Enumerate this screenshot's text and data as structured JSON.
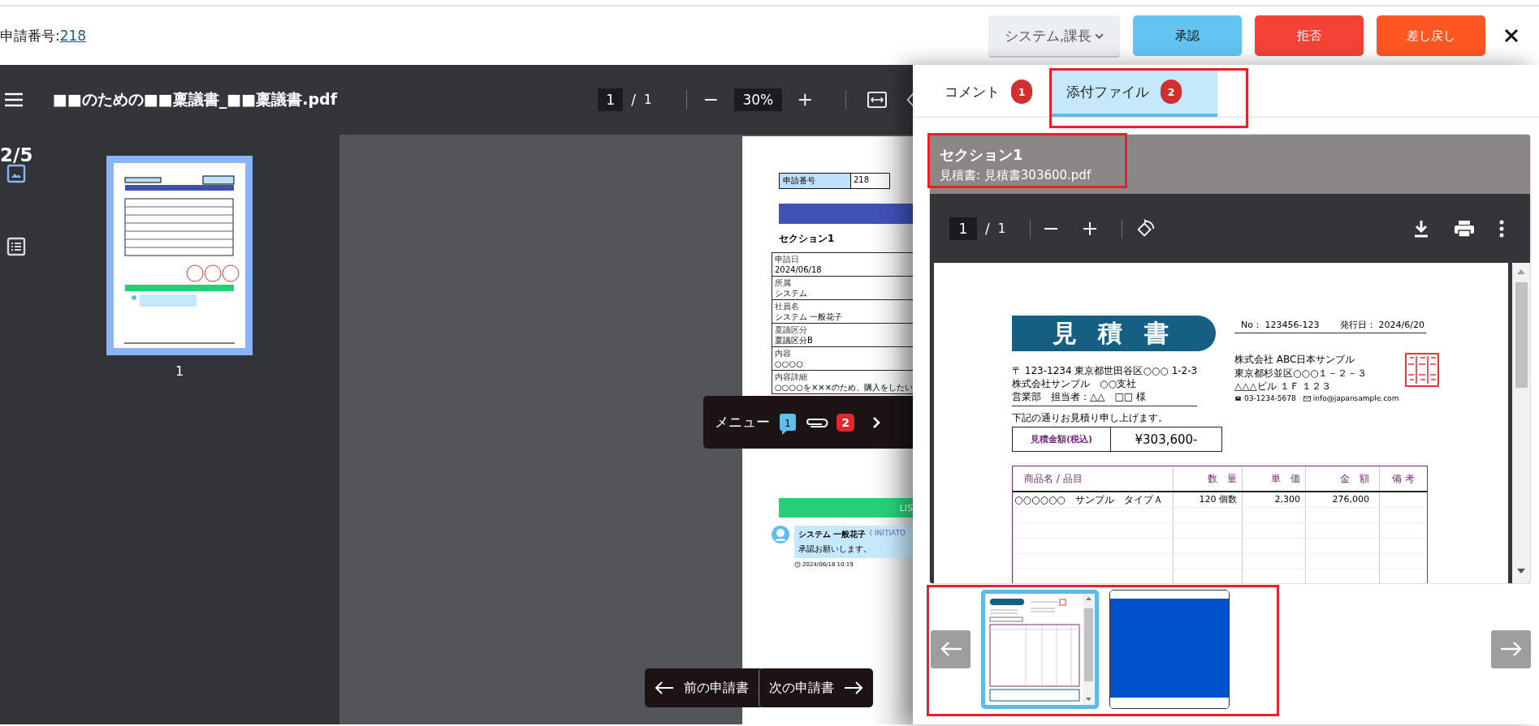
{
  "header": {
    "request_label": "申請番号:",
    "request_number": "218",
    "approver_select": "システム,課長",
    "buttons": [
      {
        "label": "承認",
        "kind": "approve"
      },
      {
        "label": "拒否",
        "kind": "reject"
      },
      {
        "label": "差し戻し",
        "kind": "return"
      }
    ]
  },
  "viewer": {
    "file_name": "■■のための■■稟議書_■■稟議書.pdf",
    "page_input": "1",
    "page_separator": "/",
    "page_total": "1",
    "zoom": "30%",
    "page_counter": "2/5",
    "views": [
      {
        "kind": "thumbnails",
        "selected": true
      },
      {
        "kind": "outline",
        "selected": false
      }
    ],
    "thumbnails": [
      {
        "label": "1",
        "selected": true
      }
    ],
    "document": {
      "request_label": "申請番号",
      "request_value": "218",
      "section_title": "セクション1",
      "fields": [
        {
          "label": "申請日",
          "value": "2024/06/18"
        },
        {
          "label": "所属",
          "value": "システム"
        },
        {
          "label": "社員名",
          "value": "システム 一般花子"
        },
        {
          "label": "稟議区分",
          "value": "稟議区分B"
        },
        {
          "label": "内容",
          "value": "○○○○"
        },
        {
          "label": "内容詳細",
          "value": "○○○○を×××のため、購入をしたい"
        }
      ],
      "comments_heading": "LIS",
      "comment": {
        "author": "システム 一般花子",
        "role": "( INITIATO",
        "text": "承認お願いします。",
        "time": "2024/06/18 10:19"
      }
    }
  },
  "floating_menu": {
    "label": "メニュー",
    "comment_count": "1",
    "attachment_count": "2"
  },
  "navigation": {
    "previous": "前の申請書",
    "next": "次の申請書"
  },
  "side_panel": {
    "tabs": [
      {
        "label": "コメント",
        "count": "1",
        "selected": false
      },
      {
        "label": "添付ファイル",
        "count": "2",
        "selected": true
      }
    ],
    "attachment": {
      "section": "セクション1",
      "file": "見積書: 見積書303600.pdf",
      "page_input": "1",
      "page_separator": "/",
      "page_total": "1",
      "estimate": {
        "title": "見 積 書",
        "number": "No： 123456-123",
        "date": "発行日： 2024/6/20",
        "recipient_lines": [
          "〒 123-1234 東京都世田谷区○○○ 1-2-3",
          "株式会社サンプル　○○支社",
          "営業部　担当者：△△　□□ 様"
        ],
        "issuer_lines": [
          "株式会社 ABC日本サンプル",
          "東京都杉並区○○○１－２－３",
          "△△△ビル １Ｆ １２３"
        ],
        "phone": "03-1234-5678",
        "email": "info@japansample.com",
        "note": "下記の通りお見積り申し上げます。",
        "amount_label": "見積金額(税込)",
        "amount": "¥303,600-",
        "columns": [
          "商品名 / 品目",
          "数　量",
          "単　価",
          "金　額",
          "備 考"
        ],
        "rows": [
          {
            "item": "○○○○○○　サンプル　タイプＡ",
            "quantity": "120",
            "unit": "個数",
            "price": "2,300",
            "total": "276,000"
          }
        ]
      }
    },
    "thumbnails": [
      {
        "kind": "document",
        "selected": true
      },
      {
        "kind": "image",
        "selected": false
      }
    ]
  }
}
